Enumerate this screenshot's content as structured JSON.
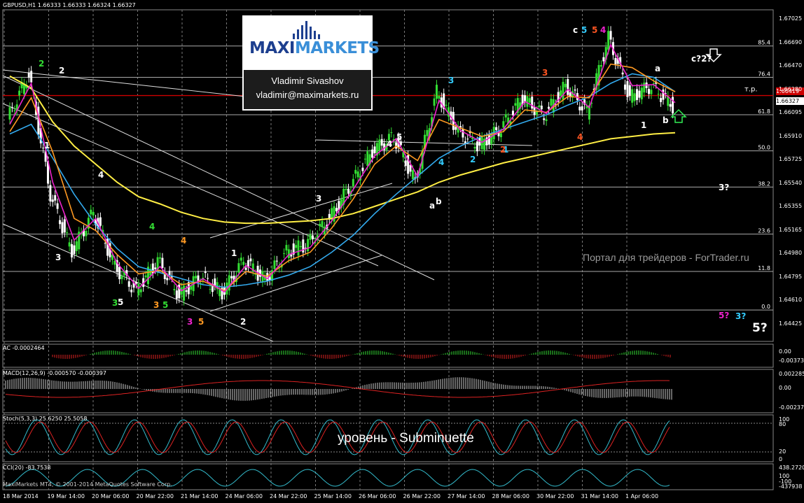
{
  "chart_data": {
    "type": "line",
    "title": "GBPUSD,H1 1.66333 1.66333 1.66324 1.66327",
    "symbol": "GBPUSD",
    "timeframe": "H1",
    "ohlc_header": [
      "1.66333",
      "1.66333",
      "1.66324",
      "1.66327"
    ],
    "y_ticks": [
      "1.67025",
      "1.66690",
      "1.66355",
      "1.66020",
      "1.65690",
      "1.65355",
      "1.65020",
      "1.64690",
      "1.64355",
      "1.64020"
    ],
    "y_ticks_display": [
      "1.67025",
      "1.66690",
      "1.66470",
      "1.66280",
      "1.66095",
      "1.65910",
      "1.65725",
      "1.65540",
      "1.65355",
      "1.65165",
      "1.64980",
      "1.64795",
      "1.64610",
      "1.64425"
    ],
    "ylim": [
      1.6438,
      1.6713
    ],
    "x_labels": [
      "18 Mar 2014",
      "19 Mar 14:00",
      "20 Mar 06:00",
      "20 Mar 22:00",
      "21 Mar 14:00",
      "24 Mar 06:00",
      "24 Mar 22:00",
      "25 Mar 14:00",
      "26 Mar 06:00",
      "26 Mar 22:00",
      "27 Mar 14:00",
      "28 Mar 06:00",
      "30 Mar 22:00",
      "31 Mar 14:00",
      "1 Apr 06:00"
    ],
    "current_price": "1.66327",
    "tp_price": "1.66419",
    "tp_label": "т.р.",
    "fib_levels": [
      {
        "label": "85.4",
        "value": 1.6683
      },
      {
        "label": "76.4",
        "value": 1.6657
      },
      {
        "label": "61.8",
        "value": 1.6626
      },
      {
        "label": "50.0",
        "value": 1.6596
      },
      {
        "label": "38.2",
        "value": 1.6566
      },
      {
        "label": "23.6",
        "value": 1.6527
      },
      {
        "label": "11.8",
        "value": 1.6496
      },
      {
        "label": "0.0",
        "value": 1.6464
      }
    ],
    "series": [
      {
        "name": "",
        "color": "#ffffff",
        "values": [
          1.6622,
          1.666,
          1.656,
          1.6512,
          1.6545,
          1.65,
          1.648,
          1.6505,
          1.6476,
          1.6492,
          1.6478,
          1.6505,
          1.6489,
          1.6512,
          1.6519,
          1.654,
          1.6568,
          1.6596,
          1.6608,
          1.657,
          1.6645,
          1.6612,
          1.66,
          1.6615,
          1.664,
          1.6625,
          1.665,
          1.6628,
          1.669,
          1.664,
          1.665,
          1.6633
        ]
      },
      {
        "name": "",
        "color": "#ffee44",
        "values": [
          1.6658,
          1.6648,
          1.662,
          1.66,
          1.6585,
          1.657,
          1.6558,
          1.6552,
          1.6545,
          1.654,
          1.6537,
          1.6536,
          1.6536,
          1.6537,
          1.6538,
          1.654,
          1.6544,
          1.655,
          1.6556,
          1.6562,
          1.657,
          1.6576,
          1.6581,
          1.6586,
          1.659,
          1.6594,
          1.6598,
          1.6602,
          1.6606,
          1.6608,
          1.661,
          1.6611
        ]
      },
      {
        "name": "",
        "color": "#33aaee",
        "values": [
          1.661,
          1.6618,
          1.659,
          1.656,
          1.6535,
          1.6515,
          1.65,
          1.6495,
          1.649,
          1.6485,
          1.6483,
          1.6485,
          1.6488,
          1.6493,
          1.65,
          1.6512,
          1.6526,
          1.6544,
          1.656,
          1.6575,
          1.659,
          1.66,
          1.6608,
          1.6614,
          1.662,
          1.6626,
          1.6634,
          1.6641,
          1.6652,
          1.666,
          1.6657,
          1.6645
        ]
      },
      {
        "name": "",
        "color": "#ff9922",
        "values": [
          1.6612,
          1.664,
          1.6595,
          1.654,
          1.653,
          1.651,
          1.6494,
          1.6497,
          1.6485,
          1.6488,
          1.648,
          1.6496,
          1.6492,
          1.6505,
          1.6512,
          1.6532,
          1.6556,
          1.6585,
          1.66,
          1.6588,
          1.6622,
          1.6615,
          1.6608,
          1.6612,
          1.663,
          1.6628,
          1.6641,
          1.664,
          1.6668,
          1.6665,
          1.6654,
          1.6645
        ]
      },
      {
        "name": "",
        "color": "#ee22cc",
        "values": [
          1.6618,
          1.6652,
          1.657,
          1.6522,
          1.654,
          1.6503,
          1.6482,
          1.65,
          1.648,
          1.649,
          1.6479,
          1.6501,
          1.649,
          1.651,
          1.6516,
          1.6538,
          1.6564,
          1.6592,
          1.6606,
          1.6575,
          1.6638,
          1.6613,
          1.6603,
          1.6614,
          1.6637,
          1.6627,
          1.6647,
          1.6632,
          1.6684,
          1.665,
          1.6651,
          1.6636
        ]
      }
    ],
    "wave_labels": [
      {
        "text": "2",
        "color": "#33dd33"
      },
      {
        "text": "2",
        "color": "#ffffff"
      },
      {
        "text": "1",
        "color": "#ffffff"
      },
      {
        "text": "3",
        "color": "#ffffff"
      },
      {
        "text": "4",
        "color": "#ffffff"
      },
      {
        "text": "3",
        "color": "#33dd33"
      },
      {
        "text": "5",
        "color": "#ffffff"
      },
      {
        "text": "4",
        "color": "#33dd33"
      },
      {
        "text": "4",
        "color": "#ff9922"
      },
      {
        "text": "3",
        "color": "#ff9922"
      },
      {
        "text": "5",
        "color": "#33dd33"
      },
      {
        "text": "3",
        "color": "#ee22cc"
      },
      {
        "text": "5",
        "color": "#ff9922"
      },
      {
        "text": "2",
        "color": "#ffffff"
      },
      {
        "text": "1",
        "color": "#ffffff"
      },
      {
        "text": "3",
        "color": "#ffffff"
      },
      {
        "text": "4",
        "color": "#ffffff"
      },
      {
        "text": "5",
        "color": "#ffffff"
      },
      {
        "text": "a",
        "color": "#ffffff"
      },
      {
        "text": "b",
        "color": "#ffffff"
      },
      {
        "text": "2",
        "color": "#33ccff"
      },
      {
        "text": "3",
        "color": "#33ccff"
      },
      {
        "text": "4",
        "color": "#33ccff"
      },
      {
        "text": "1",
        "color": "#33ccff"
      },
      {
        "text": "3",
        "color": "#ff5522"
      },
      {
        "text": "2",
        "color": "#ff5522"
      },
      {
        "text": "4",
        "color": "#ff5522"
      },
      {
        "text": "c",
        "color": "#ffffff"
      },
      {
        "text": "5",
        "color": "#33ccff"
      },
      {
        "text": "5",
        "color": "#ff5522"
      },
      {
        "text": "4",
        "color": "#ee22cc"
      },
      {
        "text": "a",
        "color": "#ffffff"
      },
      {
        "text": "1",
        "color": "#ffffff"
      },
      {
        "text": "b",
        "color": "#ffffff"
      },
      {
        "text": "c?2?",
        "color": "#ffffff"
      },
      {
        "text": "3?",
        "color": "#ffffff"
      },
      {
        "text": "5?",
        "color": "#ee22cc"
      },
      {
        "text": "3?",
        "color": "#33ccff"
      },
      {
        "text": "5?",
        "color": "#ffffff"
      }
    ],
    "subpanels": [
      {
        "name": "AC",
        "header": "AC -0.0002464",
        "ticks": [
          "0.00",
          "-0.003737"
        ]
      },
      {
        "name": "MACD",
        "header": "MACD(12,26,9) -0.000570 -0.000397",
        "ticks": [
          "0.002285",
          "0.00",
          "-0.002379"
        ]
      },
      {
        "name": "Stoch",
        "header": "Stoch(5,3,3) 25.6250 25.5058",
        "ticks": [
          "100",
          "80",
          "20",
          "0"
        ]
      },
      {
        "name": "CCI",
        "header": "CCI(20) -83.7538",
        "ticks": [
          "438.2720",
          "100",
          "-100",
          "-437938"
        ]
      }
    ]
  },
  "logo": {
    "brand_part1": "MAXI",
    "brand_part2": "MARKETS",
    "author": "Vladimir Sivashov",
    "email": "vladimir@maximarkets.ru"
  },
  "watermark": "Портал для трейдеров - ForTrader.ru",
  "annotation": "уровень - Subminuette",
  "copyright": "MaxiMarkets MT4, © 2001-2014 MetaQuotes Software Corp.",
  "colors": {
    "bull": "#33dd33",
    "bear": "#ffffff",
    "grid": "#777777",
    "tp_line": "#cc0000"
  }
}
